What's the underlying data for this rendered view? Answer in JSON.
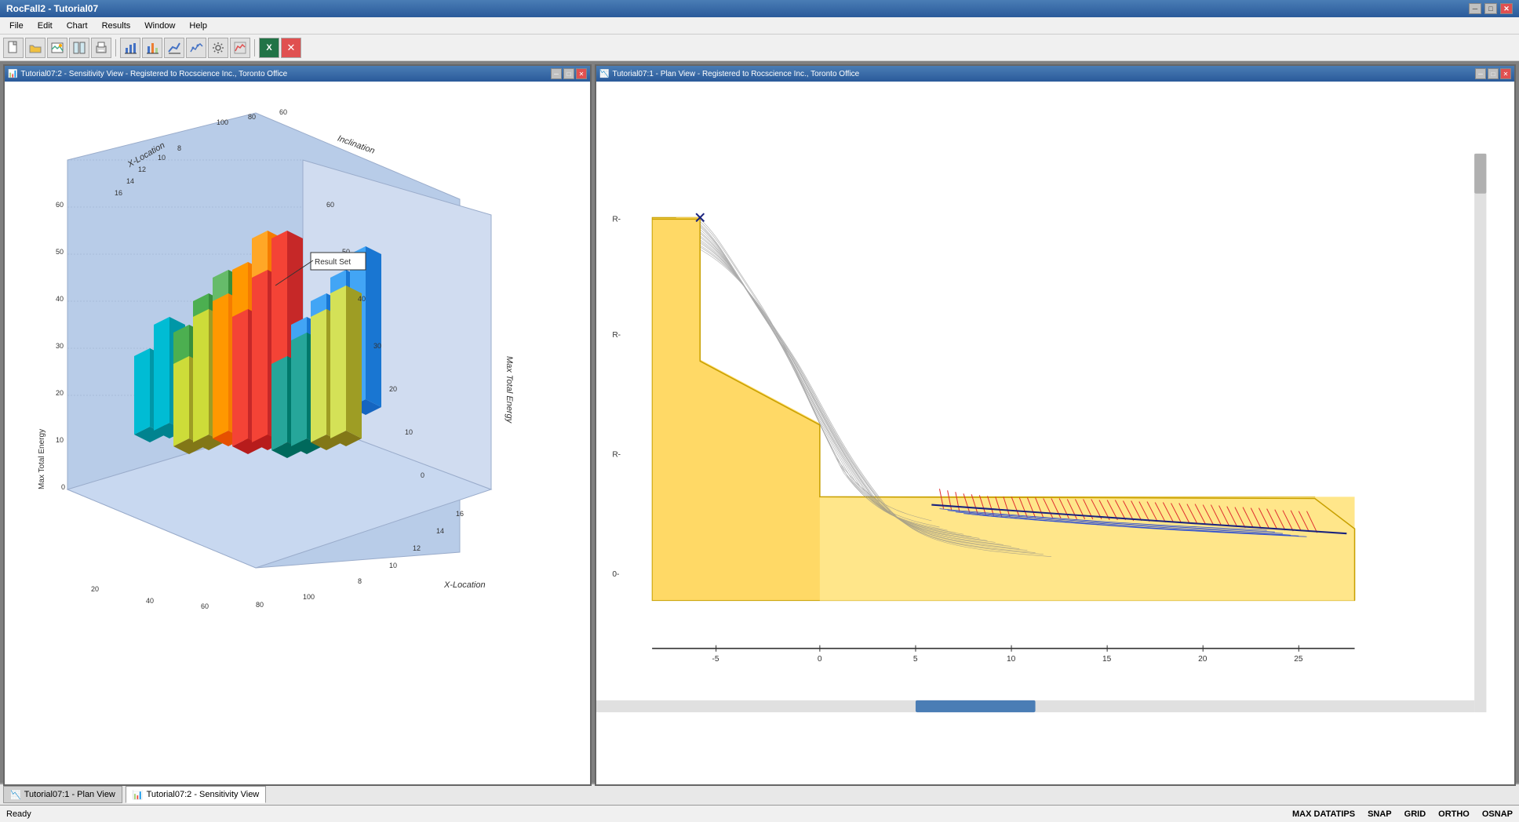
{
  "app": {
    "title": "RocFall2 - Tutorial07",
    "titlebar_controls": [
      "minimize",
      "maximize",
      "close"
    ]
  },
  "menu": {
    "items": [
      "File",
      "Edit",
      "Chart",
      "Results",
      "Window",
      "Help"
    ]
  },
  "toolbar": {
    "buttons": [
      {
        "name": "new",
        "icon": "🗋"
      },
      {
        "name": "open",
        "icon": "📂"
      },
      {
        "name": "image",
        "icon": "🖼"
      },
      {
        "name": "panel",
        "icon": "▭"
      },
      {
        "name": "print",
        "icon": "🖨"
      },
      {
        "name": "bar-chart",
        "icon": "📊"
      },
      {
        "name": "chart2",
        "icon": "📈"
      },
      {
        "name": "line-chart",
        "icon": "📉"
      },
      {
        "name": "chart3",
        "icon": "📊"
      },
      {
        "name": "settings",
        "icon": "⚙"
      },
      {
        "name": "graph",
        "icon": "📈"
      },
      {
        "name": "excel",
        "icon": "X"
      },
      {
        "name": "close-red",
        "icon": "✕"
      }
    ]
  },
  "sensitivity_panel": {
    "title": "Tutorial07:2 - Sensitivity View - Registered to Rocscience Inc., Toronto Office",
    "x_axis_label": "Inclination",
    "y_axis_label": "X-Location",
    "z_axis_label": "Max Total Energy",
    "result_set_label": "Result Set",
    "x_values": [
      20,
      40,
      60,
      80,
      100
    ],
    "y_values": [
      8,
      10,
      12,
      14,
      16
    ],
    "x_back_values": [
      100,
      80,
      60
    ],
    "y_back_values": [
      8,
      10,
      12,
      14,
      16
    ],
    "z_values": [
      0,
      10,
      20,
      30,
      40,
      50,
      60
    ]
  },
  "plan_panel": {
    "title": "Tutorial07:1 - Plan View - Registered to Rocscience Inc., Toronto Office",
    "x_axis": {
      "min": -5,
      "max": 25,
      "labels": [
        "-5",
        "0",
        "5",
        "10",
        "15",
        "20",
        "25"
      ]
    },
    "y_axis": {
      "min": -5,
      "max": 15,
      "labels": []
    }
  },
  "taskbar": {
    "items": [
      {
        "label": "Tutorial07:1 - Plan View",
        "icon": "📉",
        "active": false
      },
      {
        "label": "Tutorial07:2 - Sensitivity View",
        "icon": "📊",
        "active": false
      }
    ]
  },
  "status": {
    "ready": "Ready",
    "max_datatips": "MAX DATATIPS",
    "snap": "SNAP",
    "grid": "GRID",
    "ortho": "ORTHO",
    "osnap": "OSNAP"
  }
}
